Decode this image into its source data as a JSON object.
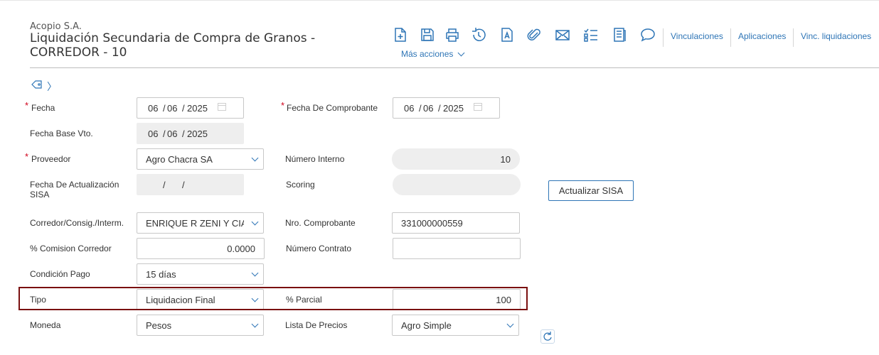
{
  "header": {
    "company": "Acopio S.A.",
    "title": "Liquidación Secundaria de Compra de Granos - CORREDOR - 10"
  },
  "toolbar": {
    "links": [
      "Vinculaciones",
      "Aplicaciones",
      "Vinc. liquidaciones"
    ],
    "more_actions": "Más acciones",
    "icons": [
      "new-document-icon",
      "save-icon",
      "print-icon",
      "undo-icon",
      "text-icon",
      "attach-icon",
      "mail-icon",
      "checklist-icon",
      "document-icon",
      "comment-icon"
    ]
  },
  "colors": {
    "accent": "#2e75b6",
    "required": "#d0021b",
    "highlight": "#7a1010"
  },
  "form": {
    "fecha": {
      "label": "Fecha",
      "day": "06",
      "month": "06",
      "year": "2025"
    },
    "fecha_comprobante": {
      "label": "Fecha De Comprobante",
      "day": "06",
      "month": "06",
      "year": "2025"
    },
    "fecha_base_vto": {
      "label": "Fecha Base Vto.",
      "day": "06",
      "month": "06",
      "year": "2025"
    },
    "proveedor": {
      "label": "Proveedor",
      "value": "Agro Chacra SA"
    },
    "numero_interno": {
      "label": "Número Interno",
      "value": "10"
    },
    "fecha_actualizacion": {
      "label": "Fecha De Actualización SISA",
      "sep": "/"
    },
    "scoring": {
      "label": "Scoring",
      "value": ""
    },
    "actualizar_sisa": "Actualizar SISA",
    "corredor": {
      "label": "Corredor/Consig./Interm.",
      "value": "ENRIQUE R ZENI Y CIA"
    },
    "nro_comprobante": {
      "label": "Nro. Comprobante",
      "value": "331000000559"
    },
    "comision": {
      "label": "% Comision Corredor",
      "value": "0.0000"
    },
    "numero_contrato": {
      "label": "Número Contrato",
      "value": ""
    },
    "condicion_pago": {
      "label": "Condición Pago",
      "value": "15 días"
    },
    "tipo": {
      "label": "Tipo",
      "value": "Liquidacion Final"
    },
    "parcial": {
      "label": "% Parcial",
      "value": "100"
    },
    "moneda": {
      "label": "Moneda",
      "value": "Pesos"
    },
    "lista_precios": {
      "label": "Lista De Precios",
      "value": "Agro Simple"
    }
  }
}
